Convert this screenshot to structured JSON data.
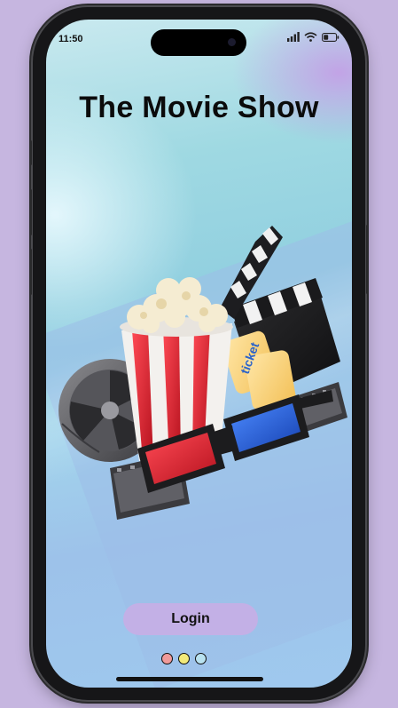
{
  "status_bar": {
    "time": "11:50"
  },
  "app": {
    "title": "The Movie Show"
  },
  "hero": {
    "icon": "cinema-objects-illustration",
    "ticket_text": "ticket"
  },
  "login": {
    "label": "Login"
  },
  "pagination": {
    "dots": [
      {
        "color": "#f09a9a",
        "active": true
      },
      {
        "color": "#f2ea7a",
        "active": false
      },
      {
        "color": "#b9e2f0",
        "active": false
      }
    ]
  },
  "colors": {
    "background": "#c6b6e0",
    "button": "#c3b0e6",
    "accent_red": "#d8202e",
    "accent_blue": "#1d57d6"
  }
}
